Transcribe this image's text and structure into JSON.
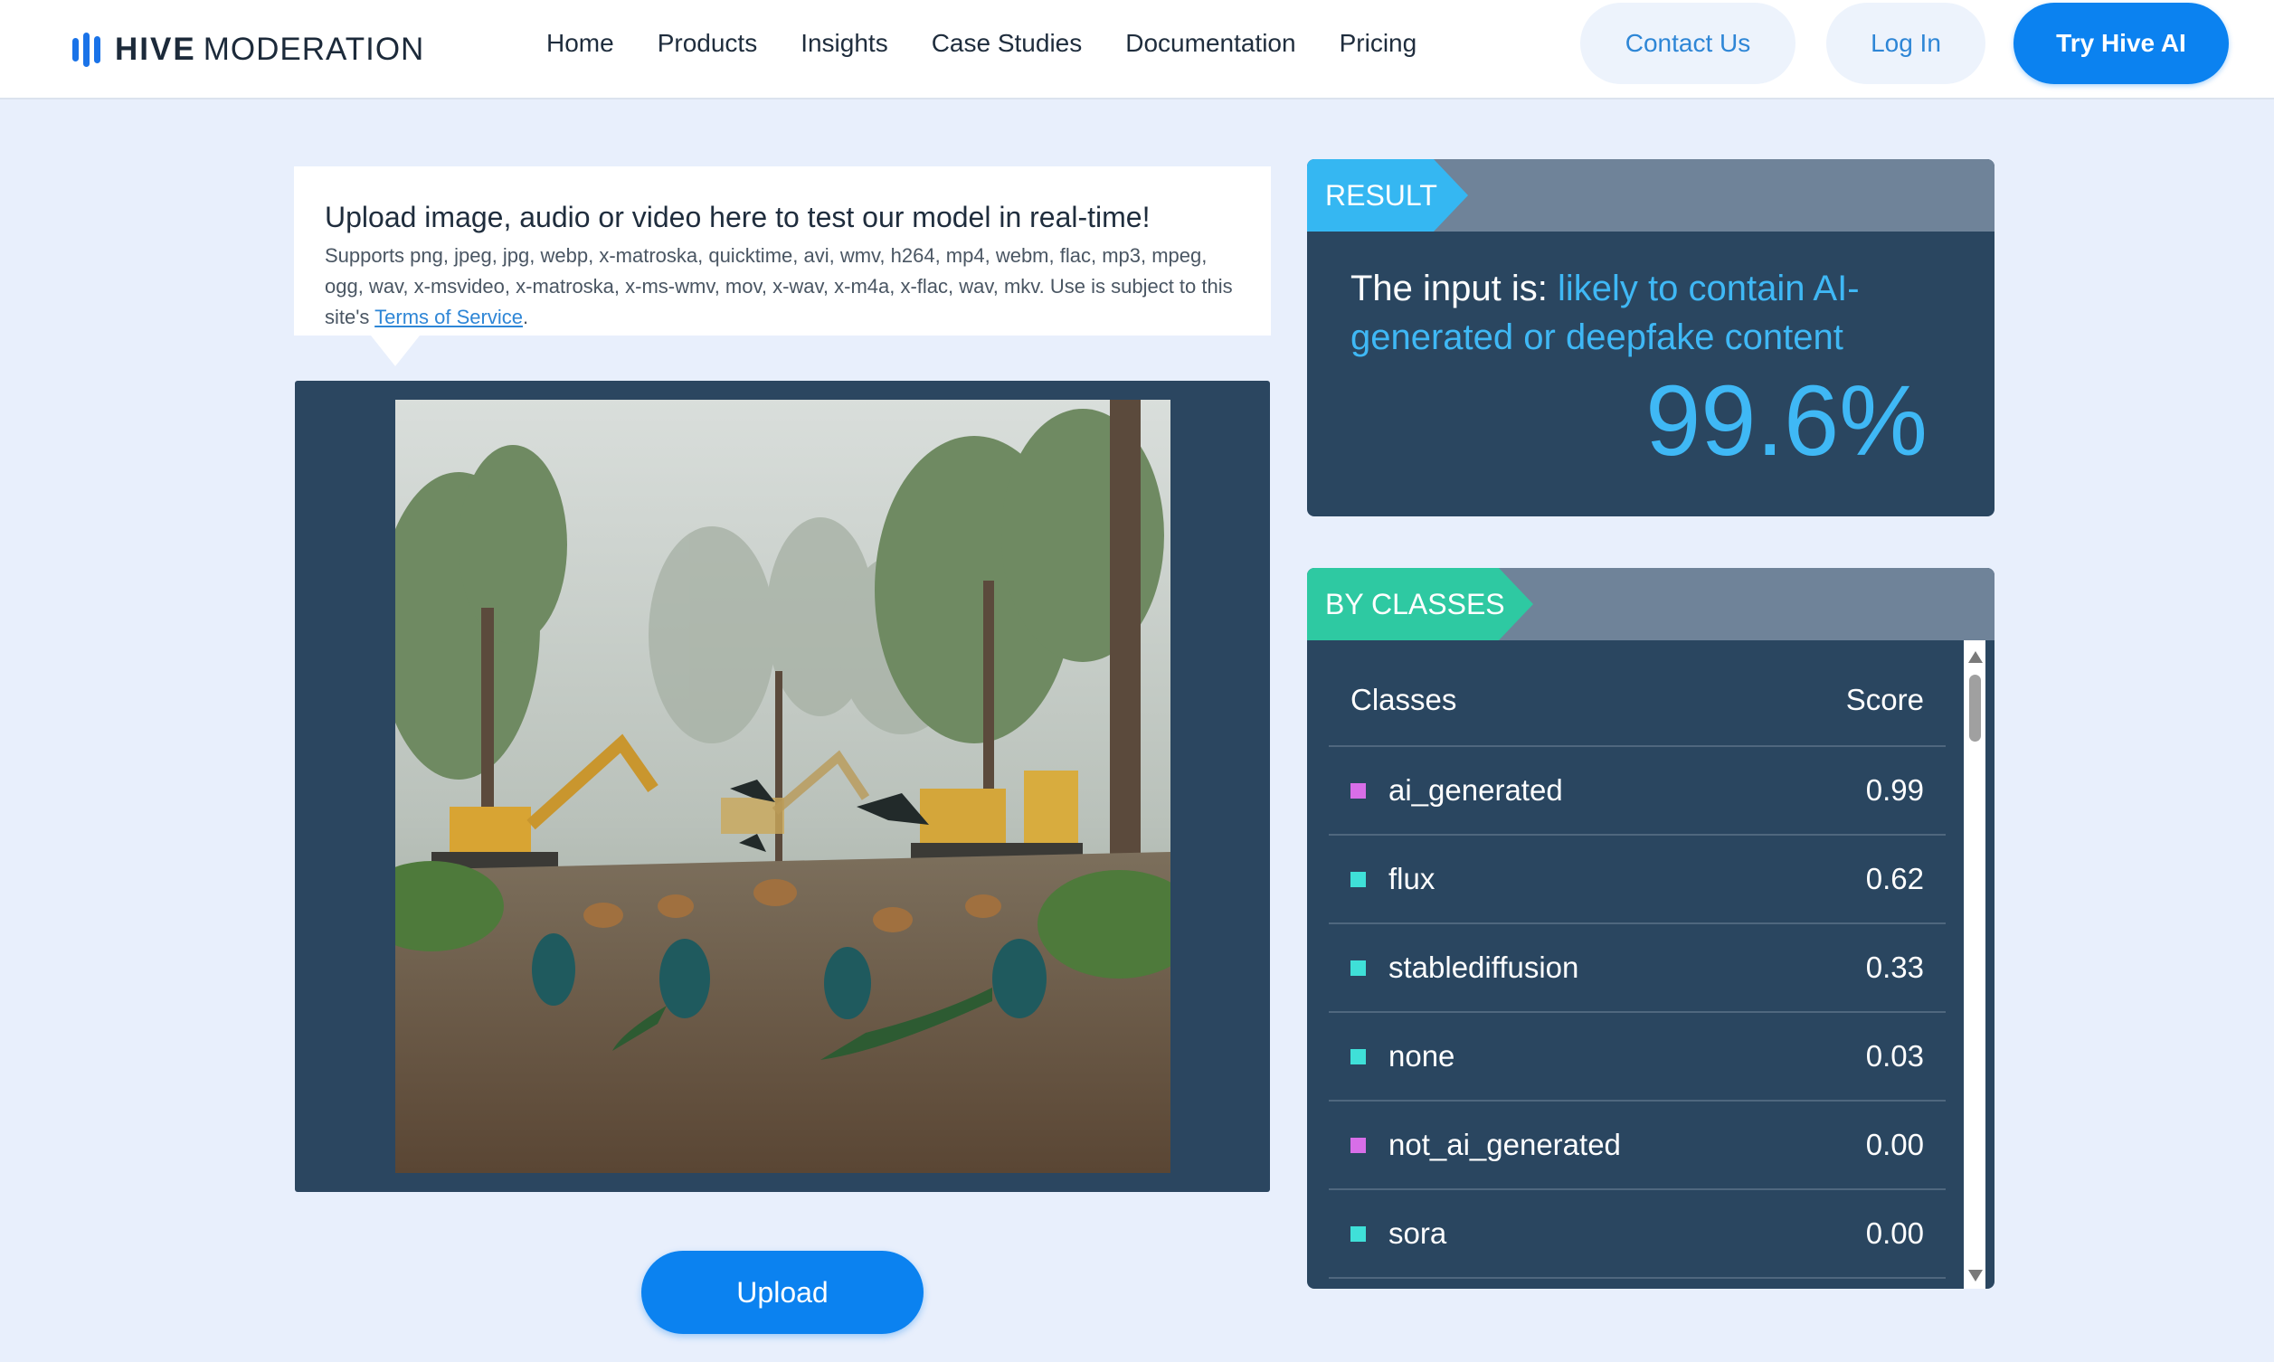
{
  "header": {
    "logo_strong": "HIVE",
    "logo_light": "MODERATION",
    "nav": [
      "Home",
      "Products",
      "Insights",
      "Case Studies",
      "Documentation",
      "Pricing"
    ],
    "contact_label": "Contact Us",
    "login_label": "Log In",
    "try_label": "Try Hive AI"
  },
  "upload": {
    "heading": "Upload image, audio or video here to test our model in real-time!",
    "supports_text": "Supports png, jpeg, jpg, webp, x-matroska, quicktime, avi, wmv, h264, mp4, webm, flac, mp3, mpeg, ogg, wav, x-msvideo, x-matroska, x-ms-wmv, mov, x-wav, x-m4a, x-flac, wav, mkv. Use is subject to this site's ",
    "terms_link": "Terms of Service",
    "terms_suffix": ".",
    "button_label": "Upload"
  },
  "result": {
    "tag": "RESULT",
    "verdict_prefix": "The input is: ",
    "verdict_highlight": "likely to contain AI-generated or deepfake content",
    "score": "99.6%"
  },
  "classes": {
    "tag": "BY CLASSES",
    "col_class": "Classes",
    "col_score": "Score",
    "rows": [
      {
        "name": "ai_generated",
        "score": "0.99",
        "color": "#d86ee8"
      },
      {
        "name": "flux",
        "score": "0.62",
        "color": "#3fe0d8"
      },
      {
        "name": "stablediffusion",
        "score": "0.33",
        "color": "#3fe0d8"
      },
      {
        "name": "none",
        "score": "0.03",
        "color": "#3fe0d8"
      },
      {
        "name": "not_ai_generated",
        "score": "0.00",
        "color": "#d86ee8"
      },
      {
        "name": "sora",
        "score": "0.00",
        "color": "#3fe0d8"
      }
    ]
  },
  "colors": {
    "accent": "#0b82f0",
    "result_tag": "#35b7f2",
    "classes_tag": "#2ec9a2",
    "panel": "#2a4660",
    "highlight": "#3fb8f5"
  }
}
